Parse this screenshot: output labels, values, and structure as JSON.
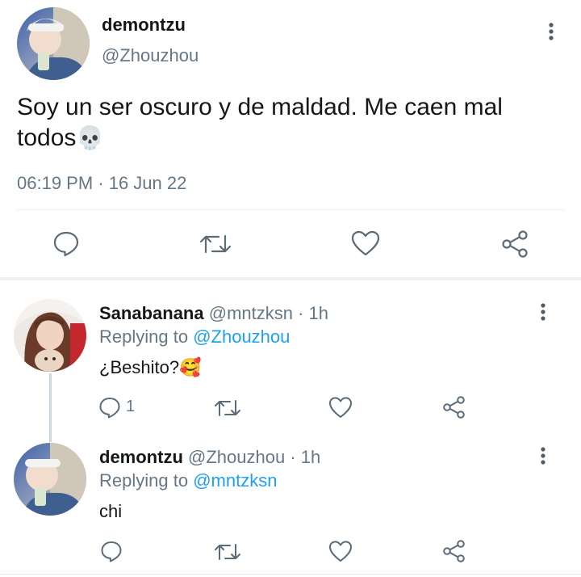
{
  "main_tweet": {
    "author_name": "demontzu",
    "author_handle": "@Zhouzhou",
    "text_line1": "Soy un ser oscuro y de maldad. Me caen mal",
    "text_line2": "todos",
    "emoji": "💀",
    "timestamp": "06:19 PM · 16 Jun 22",
    "actions": [
      "reply-icon",
      "retweet-icon",
      "like-icon",
      "share-icon"
    ]
  },
  "replies": [
    {
      "author_name": "Sanabanana",
      "author_handle": "@mntzksn",
      "time": "· 1h",
      "replying_prefix": "Replying to",
      "replying_handle": "@Zhouzhou",
      "text": "¿Beshito?",
      "emoji": "🥰",
      "reply_count": "1"
    },
    {
      "author_name": "demontzu",
      "author_handle": "@Zhouzhou",
      "time": "· 1h",
      "replying_prefix": "Replying to",
      "replying_handle": "@mntzksn",
      "text": "chi",
      "reply_count": ""
    }
  ],
  "colors": {
    "text": "#14171a",
    "secondary": "#657786",
    "link": "#1da1f2",
    "divider": "#e6ecf0"
  }
}
